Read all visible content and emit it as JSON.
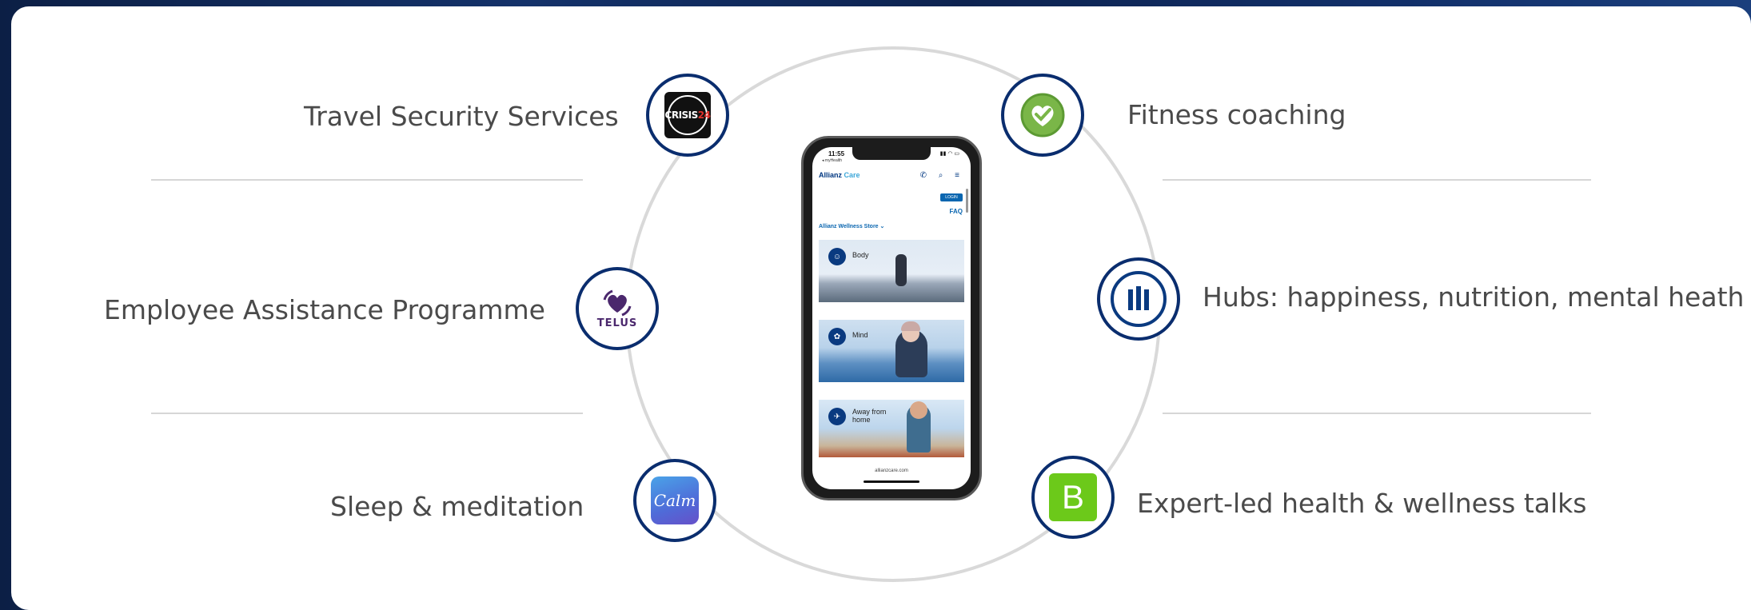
{
  "services": {
    "travel_security": "Travel Security Services",
    "employee_assistance": "Employee Assistance Programme",
    "sleep_meditation": "Sleep & meditation",
    "fitness_coaching": "Fitness coaching",
    "hubs": "Hubs: happiness, nutrition, mental heath",
    "expert_talks": "Expert-led health & wellness talks"
  },
  "logos": {
    "crisis24_main": "CRISIS",
    "crisis24_accent": "24",
    "telus": "TELUS",
    "calm": "Calm",
    "bvoice": "B"
  },
  "phone": {
    "time": "11:55",
    "back_label": "◂ myHealth",
    "status_icons": "▮▮ ◠ ▭",
    "brand_main": "Allianz ",
    "brand_accent": "Care",
    "header_icons": "✆ ⌕ ≡",
    "login_label": "LOGIN",
    "faq_label": "FAQ",
    "store_label": "Allianz Wellness Store ⌄",
    "tiles": [
      {
        "label": "Body"
      },
      {
        "label": "Mind"
      },
      {
        "label": "Away from home"
      }
    ],
    "url": "allianzcare.com"
  },
  "colors": {
    "ring": "#0a2d6e",
    "brand_blue": "#003781",
    "calm_gradient": "#4f6bd8",
    "bvoice_green": "#6cc91a",
    "fitness_green": "#7ab648"
  },
  "icons": {
    "travel_security": "crisis24-logo",
    "employee_assistance": "telus-heart-logo",
    "sleep_meditation": "calm-logo",
    "fitness_coaching": "heart-check-icon",
    "hubs": "allianz-logo",
    "expert_talks": "b-logo"
  }
}
